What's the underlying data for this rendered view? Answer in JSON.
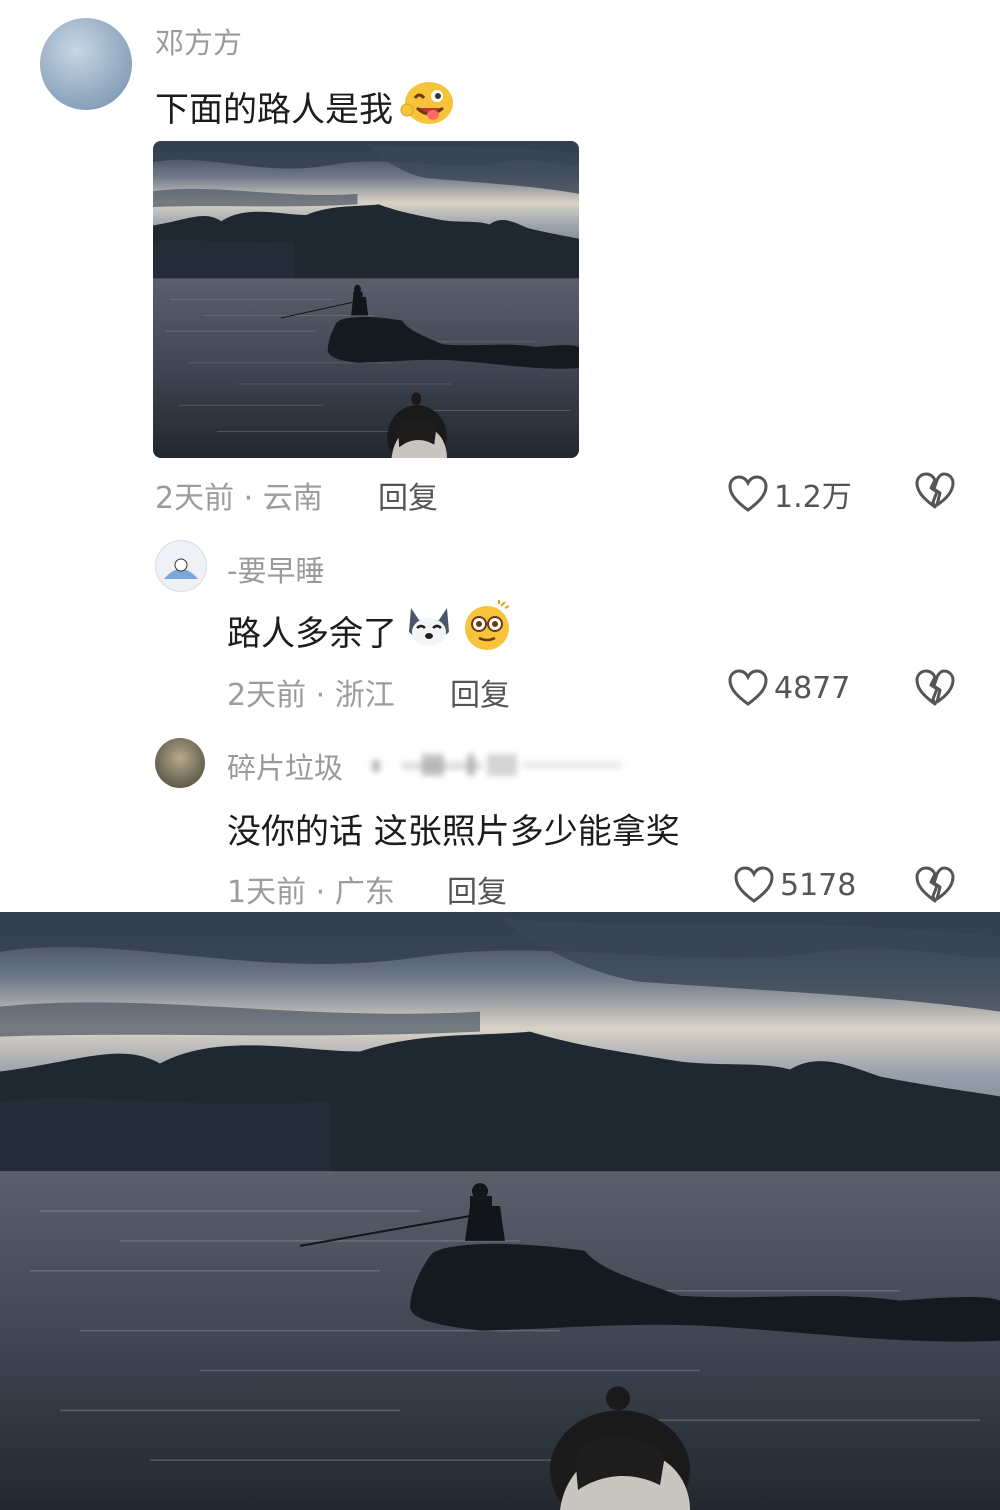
{
  "comments": [
    {
      "username": "邓方方",
      "text": "下面的路人是我",
      "meta": "2天前 · 云南",
      "reply": "回复",
      "likes": "1.2万"
    },
    {
      "username": "-要早睡",
      "text": "路人多余了",
      "meta": "2天前 · 浙江",
      "reply": "回复",
      "likes": "4877"
    },
    {
      "username": "碎片垃圾",
      "text": "没你的话 这张照片多少能拿奖",
      "meta": "1天前 · 广东",
      "reply": "回复",
      "likes": "5178"
    }
  ],
  "icons": {
    "like": "heart-outline-icon",
    "dislike": "broken-heart-icon",
    "emoji_1": "wink-tongue-emoji",
    "emoji_2": "husky-dog-emoji",
    "emoji_3": "dizzy-face-emoji"
  },
  "colors": {
    "text_primary": "#1c1c1c",
    "text_secondary": "#9a9a9a",
    "icon": "#555555"
  }
}
